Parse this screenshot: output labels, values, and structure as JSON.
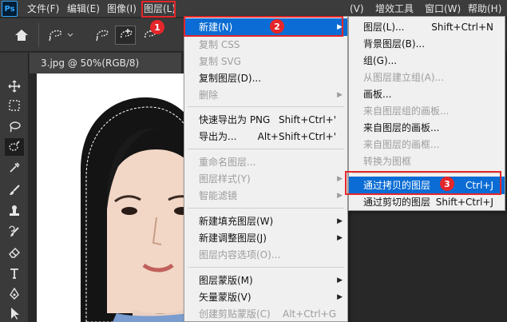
{
  "menubar": {
    "logo": "Ps",
    "items": [
      "文件(F)",
      "编辑(E)",
      "图像(I)",
      "图层(L)",
      "(V)",
      "增效工具",
      "窗口(W)",
      "帮助(H)"
    ]
  },
  "document": {
    "tab_title": "3.jpg @ 50%(RGB/8)"
  },
  "layer_menu": {
    "items": [
      {
        "label": "新建(N)",
        "shortcut": ""
      },
      {
        "label": "复制 CSS",
        "shortcut": ""
      },
      {
        "label": "复制 SVG",
        "shortcut": ""
      },
      {
        "label": "复制图层(D)...",
        "shortcut": ""
      },
      {
        "label": "删除",
        "shortcut": ""
      },
      {
        "label": "快速导出为 PNG",
        "shortcut": "Shift+Ctrl+'"
      },
      {
        "label": "导出为...",
        "shortcut": "Alt+Shift+Ctrl+'"
      },
      {
        "label": "重命名图层...",
        "shortcut": ""
      },
      {
        "label": "图层样式(Y)",
        "shortcut": ""
      },
      {
        "label": "智能滤镜",
        "shortcut": ""
      },
      {
        "label": "新建填充图层(W)",
        "shortcut": ""
      },
      {
        "label": "新建调整图层(J)",
        "shortcut": ""
      },
      {
        "label": "图层内容选项(O)...",
        "shortcut": ""
      },
      {
        "label": "图层蒙版(M)",
        "shortcut": ""
      },
      {
        "label": "矢量蒙版(V)",
        "shortcut": ""
      },
      {
        "label": "创建剪贴蒙版(C)",
        "shortcut": "Alt+Ctrl+G"
      }
    ]
  },
  "new_submenu": {
    "items": [
      {
        "label": "图层(L)...",
        "shortcut": "Shift+Ctrl+N"
      },
      {
        "label": "背景图层(B)...",
        "shortcut": ""
      },
      {
        "label": "组(G)...",
        "shortcut": ""
      },
      {
        "label": "从图层建立组(A)...",
        "shortcut": ""
      },
      {
        "label": "画板...",
        "shortcut": ""
      },
      {
        "label": "来自图层组的画板...",
        "shortcut": ""
      },
      {
        "label": "来自图层的画板...",
        "shortcut": ""
      },
      {
        "label": "来自图层的画框...",
        "shortcut": ""
      },
      {
        "label": "转换为图框",
        "shortcut": ""
      },
      {
        "label": "通过拷贝的图层",
        "shortcut": "Ctrl+J"
      },
      {
        "label": "通过剪切的图层",
        "shortcut": "Shift+Ctrl+J"
      }
    ]
  },
  "badges": [
    "1",
    "2",
    "3"
  ],
  "colors": {
    "highlight": "#0a6cd4",
    "annotation_red": "#e5262a"
  }
}
